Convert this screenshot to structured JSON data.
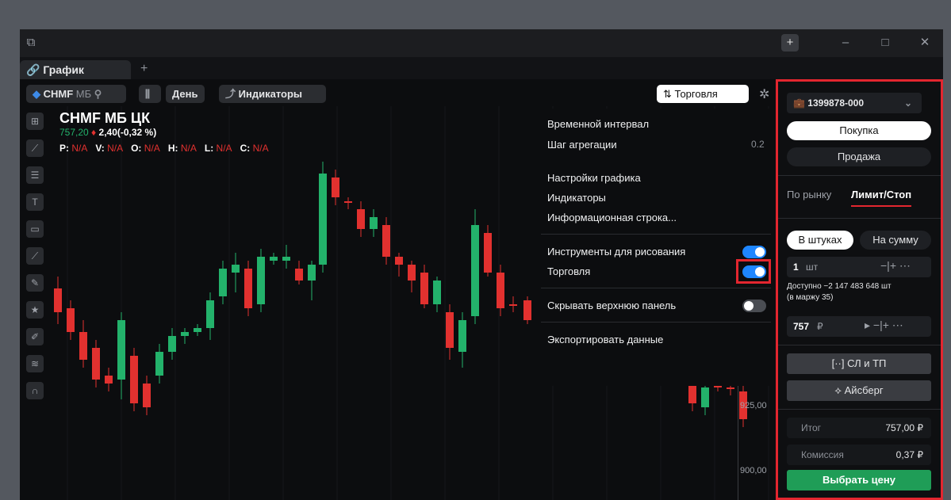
{
  "tab": {
    "title": "График",
    "add": "+"
  },
  "toolbar": {
    "ticker": "CHMF",
    "exchange": "МБ",
    "period": "День",
    "indicators": "Индикаторы",
    "trade": "Торговля"
  },
  "instrument": {
    "name": "CHMF МБ ЦК",
    "price": "757,20",
    "change": "2,40(-0,32 %)",
    "ohlc": [
      {
        "k": "P:",
        "v": "N/A"
      },
      {
        "k": "V:",
        "v": "N/A"
      },
      {
        "k": "O:",
        "v": "N/A"
      },
      {
        "k": "H:",
        "v": "N/A"
      },
      {
        "k": "L:",
        "v": "N/A"
      },
      {
        "k": "C:",
        "v": "N/A"
      }
    ]
  },
  "axis": {
    "y1": "925,00",
    "y2": "900,00"
  },
  "menu": {
    "interval": "Временной интервал",
    "aggregation": "Шаг агрегации",
    "aggregation_value": "0.2",
    "chart_settings": "Настройки графика",
    "indicators": "Индикаторы",
    "info_line": "Информационная строка...",
    "drawing_tools": "Инструменты для рисования",
    "trading": "Торговля",
    "hide_top": "Скрывать верхнюю панель",
    "export": "Экспортировать данные"
  },
  "panel": {
    "account": "1399878-000",
    "buy": "Покупка",
    "sell": "Продажа",
    "market": "По рынку",
    "limit": "Лимит/Стоп",
    "in_pieces": "В штуках",
    "in_sum": "На сумму",
    "qty": "1",
    "qty_unit": "шт",
    "available": "Доступно −2 147 483 648 шт",
    "margin": "(в маржу 35)",
    "price": "757",
    "currency": "₽",
    "sltp": "СЛ и ТП",
    "iceberg": "Айсберг",
    "total_label": "Итог",
    "total_value": "757,00 ₽",
    "commission_label": "Комиссия",
    "commission_value": "0,37 ₽",
    "choose_price": "Выбрать цену"
  },
  "colors": {
    "up": "#23b26b",
    "down": "#e2312f",
    "accent": "#1e86ff",
    "highlight": "#e3262f"
  }
}
